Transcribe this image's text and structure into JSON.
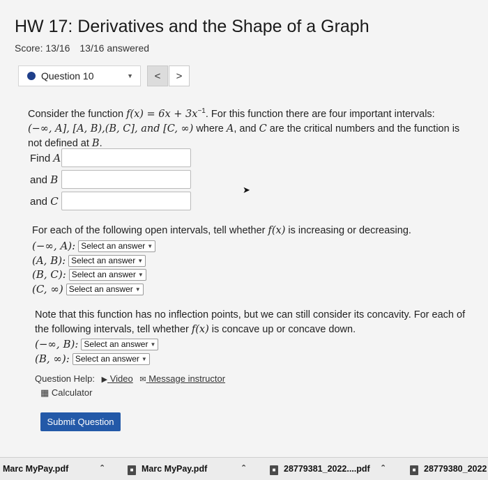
{
  "page": {
    "title": "HW 17: Derivatives and the Shape of a Graph",
    "score": "Score: 13/16",
    "answered": "13/16 answered"
  },
  "question_nav": {
    "selected": "Question 10",
    "prev": "<",
    "next": ">"
  },
  "problem": {
    "intro_a": "Consider the function ",
    "function": "f(x) = 6x + 3x",
    "exponent": "−1",
    "intro_b": ". For this function there are four important intervals:",
    "intervals": "(−∞, A], [A, B),(B, C], and [C, ∞)",
    "intro_c": " where ",
    "A": "A",
    "and_word": ", and ",
    "C": "C",
    "intro_d": " are the critical numbers and the function is not defined at ",
    "B": "B",
    "period": ".",
    "find_a": "Find",
    "and_b": "and",
    "and_c": "and"
  },
  "increasing": {
    "prompt_a": "For each of the following open intervals, tell whether ",
    "fx": "f(x)",
    "prompt_b": " is increasing or decreasing.",
    "rows": [
      {
        "interval": "(−∞, A):",
        "selected": "Select an answer"
      },
      {
        "interval": "(A, B):",
        "selected": "Select an answer"
      },
      {
        "interval": "(B, C):",
        "selected": "Select an answer"
      },
      {
        "interval": "(C, ∞)",
        "selected": "Select an answer"
      }
    ]
  },
  "concavity": {
    "prompt_a": "Note that this function has no inflection points, but we can still consider its concavity. For each of the following intervals, tell whether ",
    "fx": "f(x)",
    "prompt_b": " is concave up or concave down.",
    "rows": [
      {
        "interval": "(−∞, B):",
        "selected": "Select an answer"
      },
      {
        "interval": "(B, ∞):",
        "selected": "Select an answer"
      }
    ]
  },
  "help": {
    "label": "Question Help:",
    "video": "Video",
    "message": "Message instructor",
    "calculator": "Calculator"
  },
  "submit_label": "Submit Question",
  "downloads": [
    {
      "name": "Marc MyPay.pdf"
    },
    {
      "name": "Marc MyPay.pdf"
    },
    {
      "name": "28779381_2022....pdf"
    },
    {
      "name": "28779380_2022"
    }
  ],
  "icons": {
    "question_status": "filled-circle-icon",
    "dropdown": "caret-down-icon",
    "video": "video-icon",
    "message": "envelope-icon",
    "calculator": "calculator-icon",
    "file": "pdf-icon",
    "expand": "chevron-up-icon"
  },
  "colors": {
    "accent": "#2359a8",
    "status_dot": "#1f3f8a"
  }
}
